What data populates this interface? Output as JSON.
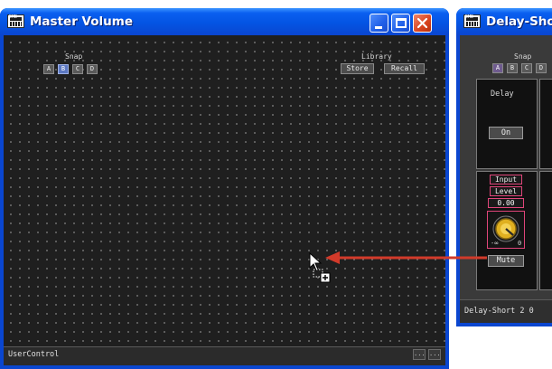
{
  "master_window": {
    "title": "Master Volume",
    "app_icon_label": "DME",
    "snap_label": "Snap",
    "snap_buttons": [
      "A",
      "B",
      "C",
      "D"
    ],
    "snap_selected": "B",
    "library_label": "Library",
    "store_label": "Store",
    "recall_label": "Recall",
    "status_text": "UserControl",
    "status_ellipsis": [
      "...",
      "..."
    ]
  },
  "delay_window": {
    "title": "Delay-Sho",
    "app_icon_label": "DME",
    "snap_label": "Snap",
    "snap_buttons": [
      "A",
      "B",
      "C",
      "D"
    ],
    "delay_label": "Delay",
    "on_label": "On",
    "input_label": "Input",
    "level_label": "Level",
    "level_value": "0.00",
    "knob_min": "-∞",
    "knob_max": "0",
    "mute_label": "Mute",
    "status_text": "Delay-Short  2 0"
  },
  "colors": {
    "xp_title_blue": "#0454e3",
    "canvas_dark": "#1f1f1f",
    "pink_outline": "#e0457a",
    "arrow_red": "#d23a2a",
    "knob_gold": "#e0b020"
  },
  "drag_indicator": "drag-copy"
}
